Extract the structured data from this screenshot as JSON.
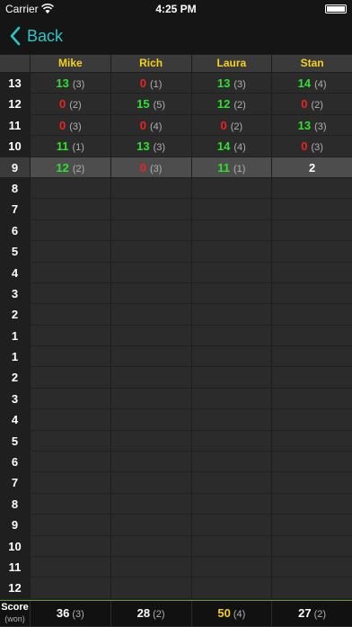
{
  "status": {
    "carrier": "Carrier",
    "time": "4:25 PM"
  },
  "nav": {
    "back_label": "Back"
  },
  "colors": {
    "accent": "#2ec4c4",
    "header_text": "#f5d020",
    "made": "#2fe02f",
    "missed": "#ee2222"
  },
  "players": [
    "Mike",
    "Rich",
    "Laura",
    "Stan"
  ],
  "rounds": [
    {
      "label": "13",
      "cells": [
        {
          "v": "13",
          "sub": "(3)",
          "c": "green"
        },
        {
          "v": "0",
          "sub": "(1)",
          "c": "red"
        },
        {
          "v": "13",
          "sub": "(3)",
          "c": "green"
        },
        {
          "v": "14",
          "sub": "(4)",
          "c": "green"
        }
      ]
    },
    {
      "label": "12",
      "cells": [
        {
          "v": "0",
          "sub": "(2)",
          "c": "red"
        },
        {
          "v": "15",
          "sub": "(5)",
          "c": "green"
        },
        {
          "v": "12",
          "sub": "(2)",
          "c": "green"
        },
        {
          "v": "0",
          "sub": "(2)",
          "c": "red"
        }
      ]
    },
    {
      "label": "11",
      "cells": [
        {
          "v": "0",
          "sub": "(3)",
          "c": "red"
        },
        {
          "v": "0",
          "sub": "(4)",
          "c": "red"
        },
        {
          "v": "0",
          "sub": "(2)",
          "c": "red"
        },
        {
          "v": "13",
          "sub": "(3)",
          "c": "green"
        }
      ]
    },
    {
      "label": "10",
      "cells": [
        {
          "v": "11",
          "sub": "(1)",
          "c": "green"
        },
        {
          "v": "13",
          "sub": "(3)",
          "c": "green"
        },
        {
          "v": "14",
          "sub": "(4)",
          "c": "green"
        },
        {
          "v": "0",
          "sub": "(3)",
          "c": "red"
        }
      ]
    },
    {
      "label": "9",
      "current": true,
      "cells": [
        {
          "v": "12",
          "sub": "(2)",
          "c": "green"
        },
        {
          "v": "0",
          "sub": "(3)",
          "c": "red"
        },
        {
          "v": "11",
          "sub": "(1)",
          "c": "green"
        },
        {
          "v": "2",
          "sub": "",
          "c": "white"
        }
      ]
    },
    {
      "label": "8",
      "cells": []
    },
    {
      "label": "7",
      "cells": []
    },
    {
      "label": "6",
      "cells": []
    },
    {
      "label": "5",
      "cells": []
    },
    {
      "label": "4",
      "cells": []
    },
    {
      "label": "3",
      "cells": []
    },
    {
      "label": "2",
      "cells": []
    },
    {
      "label": "1",
      "cells": []
    },
    {
      "label": "1",
      "cells": []
    },
    {
      "label": "2",
      "cells": []
    },
    {
      "label": "3",
      "cells": []
    },
    {
      "label": "4",
      "cells": []
    },
    {
      "label": "5",
      "cells": []
    },
    {
      "label": "6",
      "cells": []
    },
    {
      "label": "7",
      "cells": []
    },
    {
      "label": "8",
      "cells": []
    },
    {
      "label": "9",
      "cells": []
    },
    {
      "label": "10",
      "cells": []
    },
    {
      "label": "11",
      "cells": []
    },
    {
      "label": "12",
      "cells": []
    }
  ],
  "score": {
    "label": "Score",
    "sublabel": "(won)",
    "cells": [
      {
        "v": "36",
        "sub": "(3)"
      },
      {
        "v": "28",
        "sub": "(2)"
      },
      {
        "v": "50",
        "sub": "(4)",
        "leader": true
      },
      {
        "v": "27",
        "sub": "(2)"
      }
    ]
  }
}
